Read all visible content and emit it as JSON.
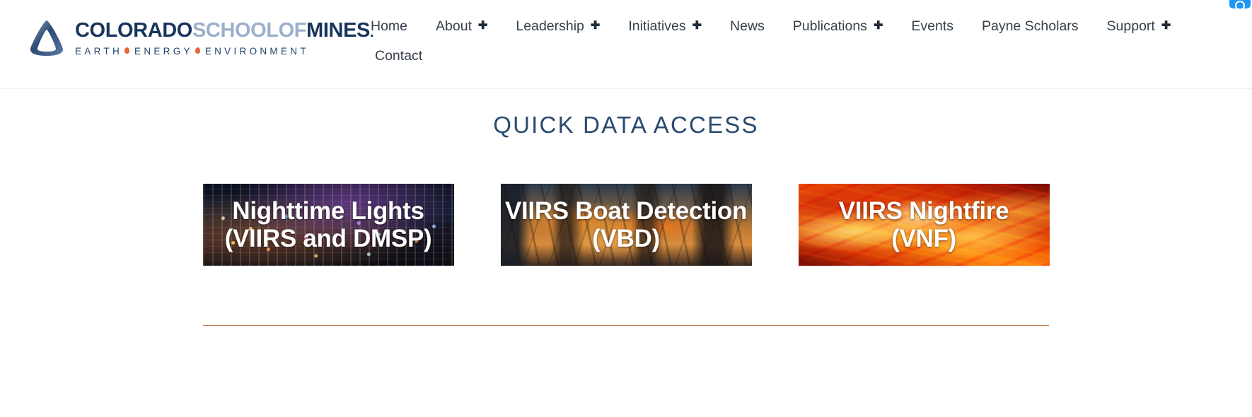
{
  "brand": {
    "logo_icon": "mines-triangle-logo-icon",
    "wordmark_part1": "COLORADO",
    "wordmark_part2": "SCHOOLOF",
    "wordmark_part3": "MINES",
    "wordmark_trademark": ".",
    "tagline_1": "EARTH",
    "tagline_2": "ENERGY",
    "tagline_3": "ENVIRONMENT",
    "accent_color": "#e8633a",
    "navy_color": "#18355c",
    "light_navy_color": "#9bb0cd"
  },
  "nav": {
    "items": [
      {
        "label": "Home",
        "has_submenu": false,
        "plus": ""
      },
      {
        "label": "About",
        "has_submenu": true,
        "plus": "✚"
      },
      {
        "label": "Leadership",
        "has_submenu": true,
        "plus": "✚"
      },
      {
        "label": "Initiatives",
        "has_submenu": true,
        "plus": "✚"
      },
      {
        "label": "News",
        "has_submenu": false,
        "plus": ""
      },
      {
        "label": "Publications",
        "has_submenu": true,
        "plus": "✚"
      },
      {
        "label": "Events",
        "has_submenu": false,
        "plus": ""
      },
      {
        "label": "Payne Scholars",
        "has_submenu": false,
        "plus": ""
      },
      {
        "label": "Support",
        "has_submenu": true,
        "plus": "✚"
      },
      {
        "label": "Contact",
        "has_submenu": false,
        "plus": ""
      }
    ]
  },
  "corner_widget": {
    "icon": "blue-rounded-badge-icon",
    "color": "#2196f3"
  },
  "main": {
    "section_title": "QUICK DATA ACCESS",
    "cards": [
      {
        "line1": "Nighttime Lights",
        "line2": "(VIIRS and DMSP)",
        "image": "nighttime-city-lights-photo"
      },
      {
        "line1": "VIIRS Boat Detection",
        "line2": "(VBD)",
        "image": "boat-rigging-dusk-photo"
      },
      {
        "line1": "VIIRS Nightfire",
        "line2": "(VNF)",
        "image": "fire-flames-photo"
      }
    ],
    "divider_color": "#c77f52"
  }
}
